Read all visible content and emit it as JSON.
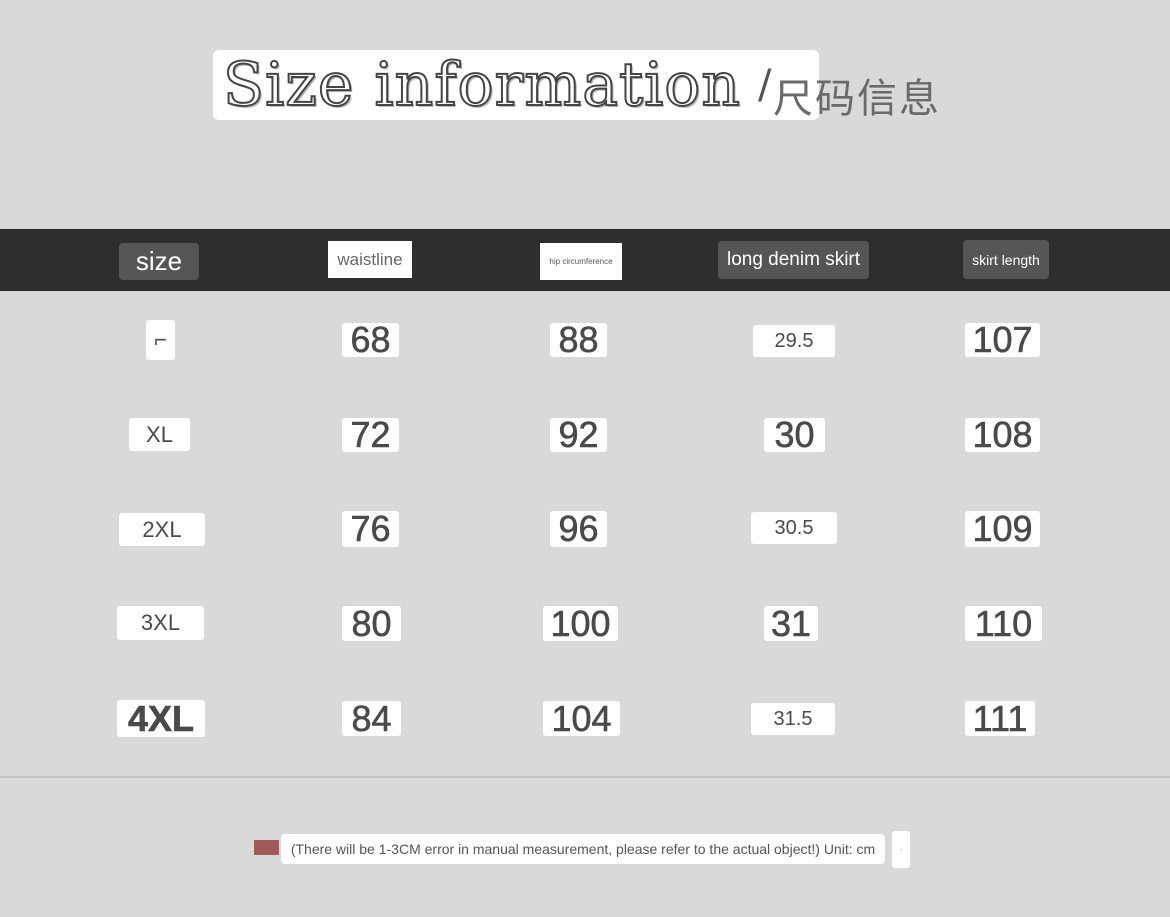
{
  "title": {
    "english": "Size information",
    "separator": "/",
    "chinese": "尺码信息"
  },
  "headers": {
    "size": "size",
    "waistline": "waistline",
    "hip": "hip circumference",
    "long_denim_skirt": "long denim skirt",
    "skirt_length": "skirt length"
  },
  "rows": [
    {
      "size": "⌐",
      "waistline": "68",
      "hip": "88",
      "long_denim_skirt": "29.5",
      "skirt_length": "107"
    },
    {
      "size": "XL",
      "waistline": "72",
      "hip": "92",
      "long_denim_skirt": "30",
      "skirt_length": "108"
    },
    {
      "size": "2XL",
      "waistline": "76",
      "hip": "96",
      "long_denim_skirt": "30.5",
      "skirt_length": "109"
    },
    {
      "size": "3XL",
      "waistline": "80",
      "hip": "100",
      "long_denim_skirt": "31",
      "skirt_length": "110"
    },
    {
      "size": "4XL",
      "waistline": "84",
      "hip": "104",
      "long_denim_skirt": "31.5",
      "skirt_length": "111"
    }
  ],
  "note": {
    "text": "(There will be 1-3CM error in manual measurement, please refer to the actual object!) Unit: cm",
    "trailing": "·"
  },
  "colors": {
    "background": "#d9d9d9",
    "header_bar": "#2e2e2e",
    "header_label_dark": "#555555",
    "note_swatch": "#a05a5a"
  }
}
